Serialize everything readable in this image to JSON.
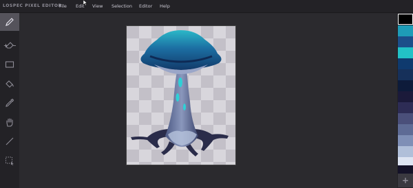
{
  "app": {
    "name": "LOSPEC PIXEL EDITOR"
  },
  "menu": {
    "items": [
      {
        "label": "File"
      },
      {
        "label": "Edit"
      },
      {
        "label": "View"
      },
      {
        "label": "Selection"
      },
      {
        "label": "Editor"
      },
      {
        "label": "Help"
      }
    ]
  },
  "toolbar": {
    "tools": [
      {
        "name": "pencil-tool",
        "icon": "pencil-icon",
        "active": true
      },
      {
        "name": "eraser-tool",
        "icon": "eraser-icon",
        "active": false
      },
      {
        "name": "rectangle-tool",
        "icon": "rectangle-icon",
        "active": false
      },
      {
        "name": "fill-tool",
        "icon": "paint-bucket-icon",
        "active": false
      },
      {
        "name": "eyedropper-tool",
        "icon": "eyedropper-icon",
        "active": false
      },
      {
        "name": "pan-tool",
        "icon": "hand-icon",
        "active": false
      },
      {
        "name": "line-tool",
        "icon": "line-icon",
        "active": false
      },
      {
        "name": "select-tool",
        "icon": "rectangle-select-icon",
        "active": false
      }
    ],
    "size_increase": "+",
    "size_decrease": "−"
  },
  "palette": {
    "selected_index": 0,
    "colors": [
      "#000000",
      "#1e9cb7",
      "#1c4e8a",
      "#22c1c6",
      "#0f3a6e",
      "#16305a",
      "#0d1b3a",
      "#1b1a3a",
      "#2d2c55",
      "#4a4f7a",
      "#5e6b95",
      "#7f8fb6",
      "#b0bfd9",
      "#dde4f2",
      "#5c5a82",
      "#141228"
    ],
    "add_label": "+"
  },
  "canvas": {
    "subject": "pixel-art mushroom"
  }
}
